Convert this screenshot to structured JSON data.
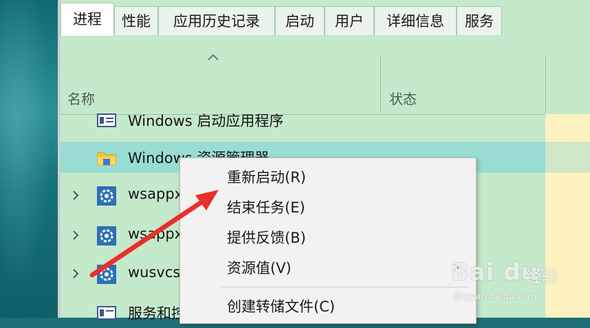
{
  "tabs": [
    {
      "label": "进程",
      "active": true
    },
    {
      "label": "性能"
    },
    {
      "label": "应用历史记录"
    },
    {
      "label": "启动"
    },
    {
      "label": "用户"
    },
    {
      "label": "详细信息"
    },
    {
      "label": "服务"
    }
  ],
  "columns": {
    "name": "名称",
    "status": "状态"
  },
  "rows": [
    {
      "label": "Windows 启动应用程序",
      "icon": "app-window-icon",
      "expandable": false
    },
    {
      "label": "Windows 资源管理器",
      "icon": "folder-icon",
      "expandable": false,
      "selected": true
    },
    {
      "label": "wsappx",
      "icon": "gear-icon",
      "expandable": true
    },
    {
      "label": "wsappx",
      "icon": "gear-icon",
      "expandable": true
    },
    {
      "label": "wusvcs",
      "icon": "gear-icon",
      "expandable": true
    },
    {
      "label": "服务和控制器应用",
      "icon": "app-window-icon",
      "expandable": false
    }
  ],
  "context_menu": {
    "items": [
      {
        "label": "重新启动(R)",
        "submenu": false
      },
      {
        "label": "结束任务(E)",
        "submenu": false
      },
      {
        "label": "提供反馈(B)",
        "submenu": false
      },
      {
        "label": "资源值(V)",
        "submenu": true
      },
      {
        "label": "创建转储文件(C)",
        "submenu": false
      }
    ]
  },
  "watermark": {
    "brand": "Bai du",
    "suffix": "经验",
    "url": "jingyan.baidu.com"
  },
  "colors": {
    "accent_bg": "#c5e9cb",
    "selected_row": "#98dcd3",
    "status_column": "#fdf3c0",
    "annotation_arrow": "#e8302a"
  }
}
